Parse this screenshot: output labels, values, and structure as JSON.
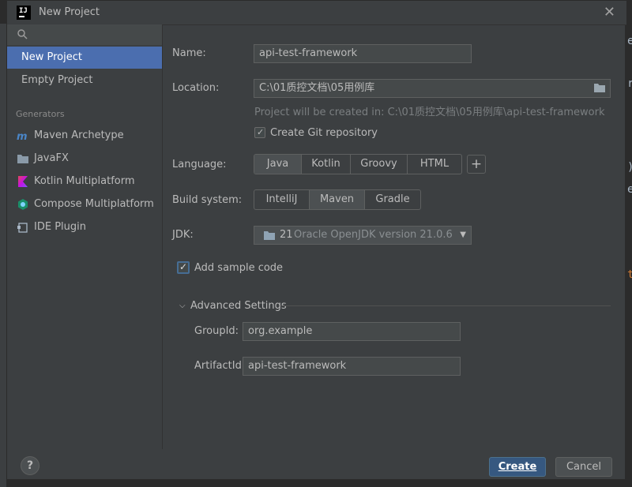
{
  "window": {
    "title": "New Project",
    "app_icon_text": "IJ"
  },
  "sidebar": {
    "items": [
      {
        "label": "New Project",
        "selected": true
      },
      {
        "label": "Empty Project",
        "selected": false
      }
    ],
    "generators_heading": "Generators",
    "generators": [
      {
        "label": "Maven Archetype",
        "icon": "maven-icon"
      },
      {
        "label": "JavaFX",
        "icon": "folder-icon"
      },
      {
        "label": "Kotlin Multiplatform",
        "icon": "kotlin-icon"
      },
      {
        "label": "Compose Multiplatform",
        "icon": "compose-icon"
      },
      {
        "label": "IDE Plugin",
        "icon": "plugin-icon"
      }
    ]
  },
  "form": {
    "name_label": "Name:",
    "name_value": "api-test-framework",
    "location_label": "Location:",
    "location_value": "C:\\01质控文档\\05用例库",
    "location_hint": "Project will be created in: C:\\01质控文档\\05用例库\\api-test-framework",
    "git_label": "Create Git repository",
    "git_checked": true,
    "language_label": "Language:",
    "languages": [
      "Java",
      "Kotlin",
      "Groovy",
      "HTML"
    ],
    "language_selected": "Java",
    "add_language_label": "+",
    "build_label": "Build system:",
    "build_systems": [
      "IntelliJ",
      "Maven",
      "Gradle"
    ],
    "build_selected": "Maven",
    "jdk_label": "JDK:",
    "jdk_version": "21",
    "jdk_name": "Oracle OpenJDK version 21.0.6",
    "sample_label": "Add sample code",
    "sample_checked": true,
    "advanced_label": "Advanced Settings",
    "groupid_label": "GroupId:",
    "groupid_value": "org.example",
    "artifactid_label": "ArtifactId:",
    "artifactid_value": "api-test-framework"
  },
  "footer": {
    "help_label": "?",
    "create_label": "Create",
    "cancel_label": "Cancel"
  },
  "colors": {
    "selection": "#4b6eaf",
    "primary_button": "#365880",
    "dialog_bg": "#3c3f41"
  }
}
